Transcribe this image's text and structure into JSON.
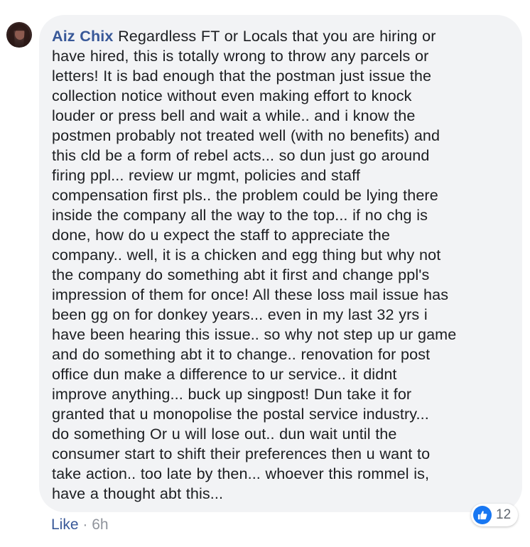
{
  "comment": {
    "author": "Aiz Chix",
    "lines": [
      "Regardless FT or Locals that you are hiring or",
      "have hired, this is totally wrong to throw any parcels or",
      "letters! It is bad enough that the postman just issue the",
      "collection notice without even making effort to knock",
      "louder or press bell and wait a while.. and i know the",
      "postmen probably not treated well (with no benefits) and",
      "this cld be a form of rebel acts... so dun just go around",
      "firing ppl... review ur mgmt, policies and staff",
      "compensation first pls.. the problem could be lying there",
      "inside the company all the way to the top... if no chg is",
      "done, how do u expect the staff to appreciate the",
      "company.. well, it is a chicken and egg thing but why not",
      "the company do something abt it first and change ppl's",
      "impression of them for once! All these loss mail issue has",
      "been gg on for donkey years... even in my last 32 yrs i",
      "have been hearing this issue.. so why not step up ur game",
      "and do something abt it to change.. renovation for post",
      "office dun make a difference to ur service.. it didnt",
      "improve anything... buck up singpost! Dun take it for",
      "granted that u monopolise the postal service industry...",
      "do something Or u will lose out.. dun wait until the",
      "consumer start to shift their preferences then u want to",
      "take action.. too late by then... whoever this rommel is,",
      "have a thought abt this..."
    ]
  },
  "reactions": {
    "icon": "thumbs-up-icon",
    "count": "12",
    "color": "#1877f2"
  },
  "actions": {
    "like_label": "Like",
    "separator": "·",
    "timestamp": "6h"
  },
  "colors": {
    "author": "#385898",
    "bubble": "#f2f3f5",
    "text": "#1c1e21",
    "meta": "#90949c"
  }
}
